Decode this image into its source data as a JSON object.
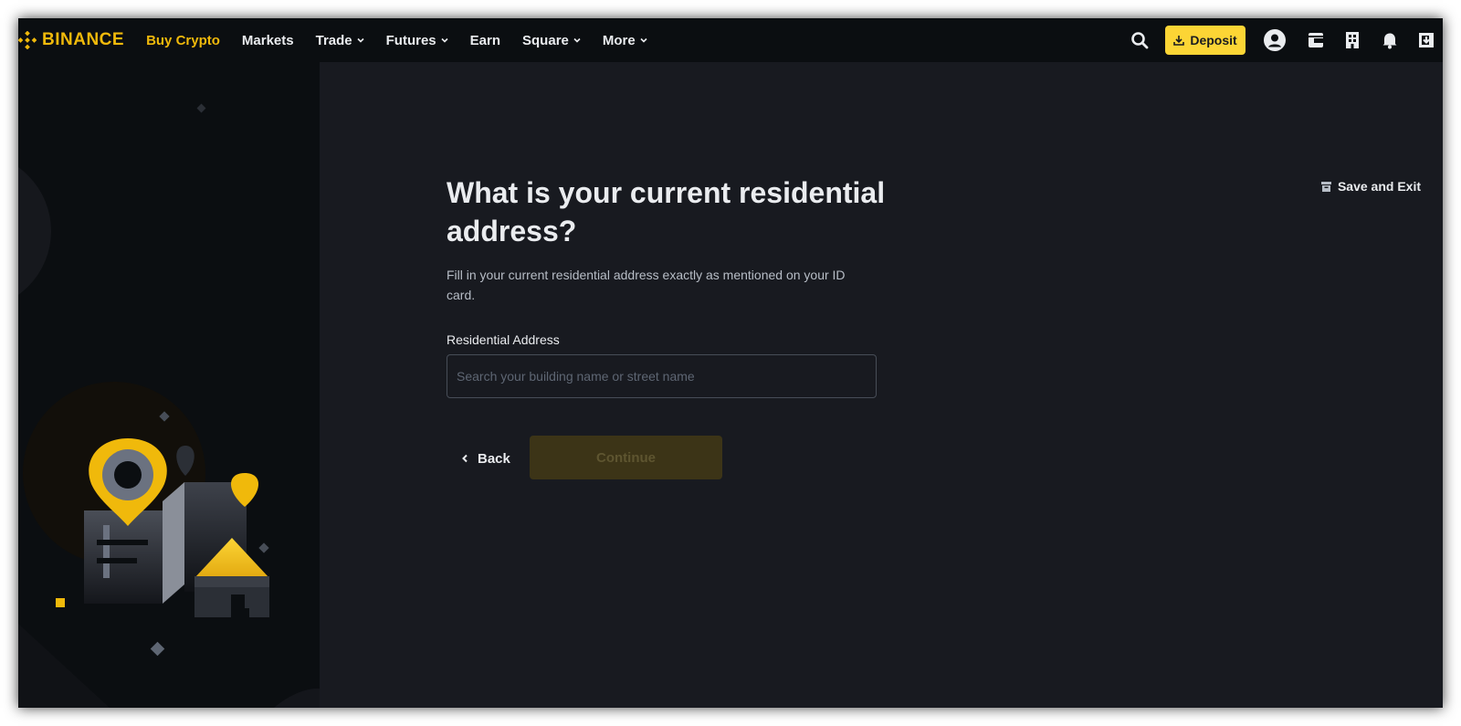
{
  "brand": {
    "name": "BINANCE",
    "accent": "#f0b90b"
  },
  "nav": {
    "items": [
      {
        "label": "Buy Crypto",
        "active": true,
        "dropdown": false
      },
      {
        "label": "Markets",
        "active": false,
        "dropdown": false
      },
      {
        "label": "Trade",
        "active": false,
        "dropdown": true
      },
      {
        "label": "Futures",
        "active": false,
        "dropdown": true
      },
      {
        "label": "Earn",
        "active": false,
        "dropdown": false
      },
      {
        "label": "Square",
        "active": false,
        "dropdown": true
      },
      {
        "label": "More",
        "active": false,
        "dropdown": true
      }
    ]
  },
  "header_actions": {
    "deposit_label": "Deposit",
    "icons": [
      "search-icon",
      "download-icon",
      "user-icon",
      "wallet-icon",
      "orders-icon",
      "bell-icon",
      "download-app-icon"
    ]
  },
  "form": {
    "title": "What is your current residential address?",
    "subtitle": "Fill in your current residential address exactly as mentioned on your ID card.",
    "address_label": "Residential Address",
    "address_placeholder": "Search your building name or street name",
    "address_value": "",
    "back_label": "Back",
    "continue_label": "Continue",
    "continue_enabled": false,
    "save_exit_label": "Save and Exit"
  },
  "colors": {
    "page_bg": "#181a20",
    "topbar_bg": "#0b0e11",
    "primary": "#fcd535",
    "text": "#eaecef",
    "text_secondary": "#b7bdc6"
  }
}
